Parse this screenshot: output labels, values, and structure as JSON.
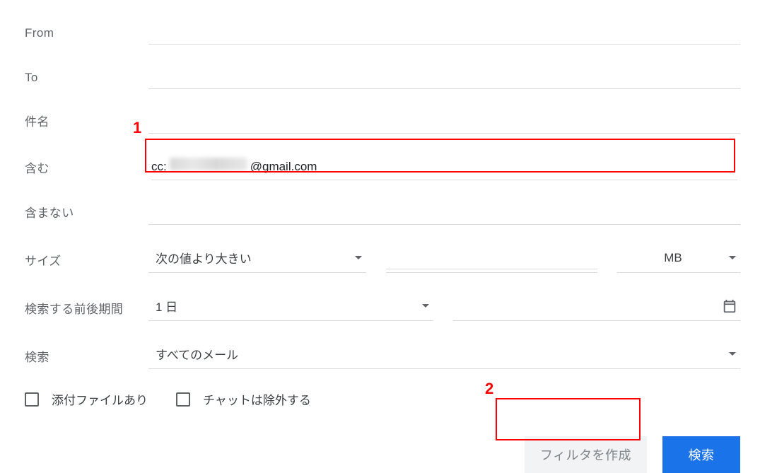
{
  "labels": {
    "from": "From",
    "to": "To",
    "subject": "件名",
    "contains": "含む",
    "notContains": "含まない",
    "size": "サイズ",
    "dateRange": "検索する前後期間",
    "searchIn": "検索"
  },
  "fields": {
    "from": "",
    "to": "",
    "subject": "",
    "contains_prefix": "cc:",
    "contains_suffix": "@gmail.com",
    "notContains": "",
    "sizeOperator": "次の値より大きい",
    "sizeValue": "",
    "sizeUnit": "MB",
    "dateRange": "1 日",
    "dateValue": "",
    "searchIn": "すべてのメール"
  },
  "checkboxes": {
    "hasAttachment": "添付ファイルあり",
    "excludeChats": "チャットは除外する"
  },
  "buttons": {
    "createFilter": "フィルタを作成",
    "search": "検索"
  },
  "annotations": {
    "one": "1",
    "two": "2"
  }
}
